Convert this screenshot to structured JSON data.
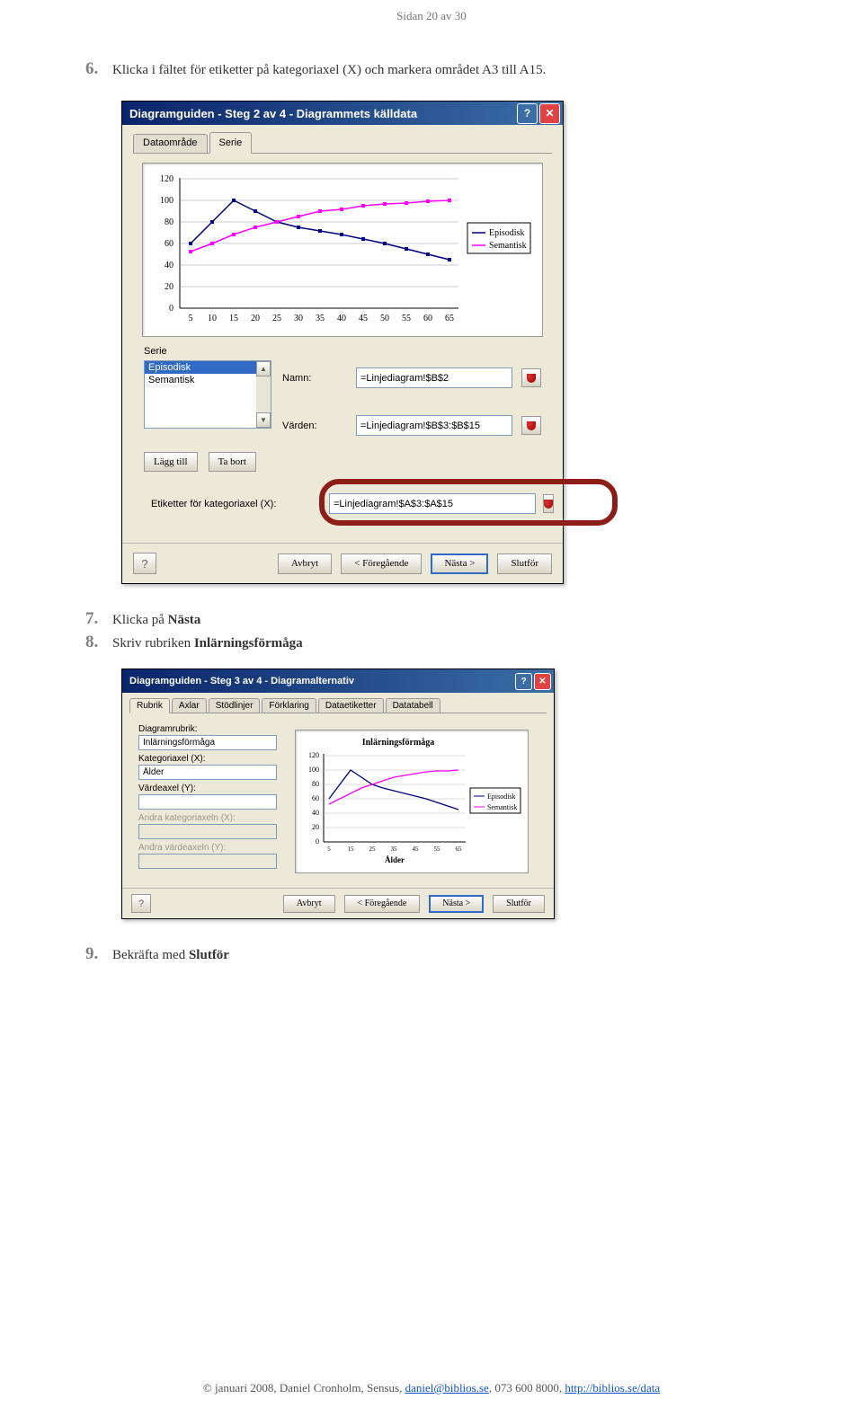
{
  "pager": "Sidan 20 av 30",
  "steps": {
    "n6": "6.",
    "s6": "Klicka i fältet för etiketter på kategoriaxel (X) och markera området A3 till A15.",
    "n7": "7.",
    "s7_a": "Klicka på ",
    "s7_b": "Nästa",
    "n8": "8.",
    "s8_a": "Skriv rubriken ",
    "s8_b": "Inlärningsförmåga",
    "n9": "9.",
    "s9_a": "Bekräfta med ",
    "s9_b": "Slutför"
  },
  "dlg1": {
    "title": "Diagramguiden - Steg 2 av 4 - Diagrammets källdata",
    "tab1": "Dataområde",
    "tab2": "Serie",
    "serie_label": "Serie",
    "list_item1": "Episodisk",
    "list_item2": "Semantisk",
    "btn_add": "Lägg till",
    "btn_del": "Ta bort",
    "namn_label": "Namn:",
    "namn_val": "=Linjediagram!$B$2",
    "varden_label": "Värden:",
    "varden_val": "=Linjediagram!$B$3:$B$15",
    "cat_label": "Etiketter för kategoriaxel (X):",
    "cat_val": "=Linjediagram!$A$3:$A$15",
    "legend1": "Episodisk",
    "legend2": "Semantisk",
    "btn_cancel": "Avbryt",
    "btn_back": "< Föregående",
    "btn_next": "Nästa >",
    "btn_finish": "Slutför"
  },
  "dlg2": {
    "title": "Diagramguiden - Steg 3 av 4 - Diagramalternativ",
    "tabs": [
      "Rubrik",
      "Axlar",
      "Stödlinjer",
      "Förklaring",
      "Dataetiketter",
      "Datatabell"
    ],
    "lbl_rubrik": "Diagramrubrik:",
    "val_rubrik": "Inlärningsförmåga",
    "lbl_katx": "Kategoriaxel (X):",
    "val_katx": "Ålder",
    "lbl_valy": "Värdeaxel (Y):",
    "val_valy": "",
    "lbl_katx2": "Andra kategoriaxeln (X):",
    "lbl_valy2": "Andra värdeaxeln (Y):",
    "chart_title": "Inlärningsförmåga",
    "chart_xlabel": "Ålder",
    "legend1": "Episodisk",
    "legend2": "Semantisk",
    "btn_cancel": "Avbryt",
    "btn_back": "< Föregående",
    "btn_next": "Nästa >",
    "btn_finish": "Slutför"
  },
  "chart_data": {
    "type": "line",
    "x": [
      5,
      10,
      15,
      20,
      25,
      30,
      35,
      40,
      45,
      50,
      55,
      60,
      65
    ],
    "series": [
      {
        "name": "Episodisk",
        "values": [
          60,
          80,
          100,
          90,
          80,
          75,
          72,
          68,
          64,
          60,
          55,
          50,
          45
        ],
        "color": "#000080"
      },
      {
        "name": "Semantisk",
        "values": [
          52,
          60,
          68,
          75,
          80,
          85,
          90,
          92,
          95,
          97,
          98,
          99,
          100
        ],
        "color": "#FF00FF"
      }
    ],
    "ylim": [
      0,
      120
    ],
    "yticks": [
      0,
      20,
      40,
      60,
      80,
      100,
      120
    ],
    "title": "Inlärningsförmåga",
    "xlabel": "Ålder"
  },
  "footer": {
    "prefix": "© januari 2008, Daniel Cronholm, Sensus, ",
    "email": "daniel@biblios.se",
    "mid": ", 073 600 8000, ",
    "url": "http://biblios.se/data"
  }
}
